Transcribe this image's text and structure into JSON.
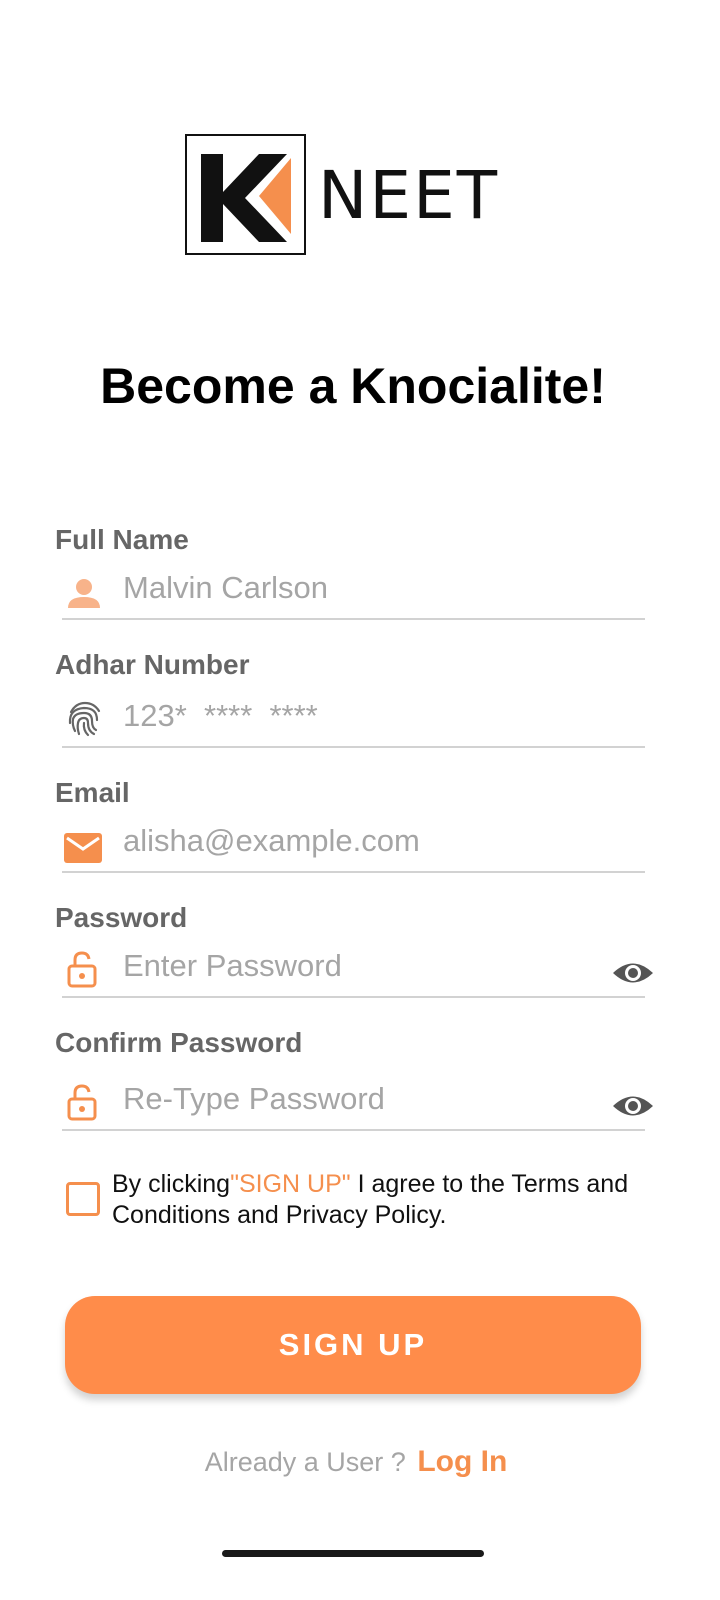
{
  "logo": {
    "letter": "K",
    "wordmark": "NEET",
    "accent_color": "#F58F4D"
  },
  "title": "Become a Knocialite!",
  "form": {
    "full_name": {
      "label": "Full Name",
      "placeholder": "Malvin Carlson",
      "icon": "person-icon"
    },
    "adhar": {
      "label": "Adhar Number",
      "placeholder": "123*  ****  ****",
      "icon": "fingerprint-icon"
    },
    "email": {
      "label": "Email",
      "placeholder": "alisha@example.com",
      "icon": "mail-icon"
    },
    "password": {
      "label": "Password",
      "placeholder": "Enter Password",
      "icon": "lock-icon",
      "toggle_icon": "eye-icon"
    },
    "confirm_password": {
      "label": "Confirm Password",
      "placeholder": "Re-Type Password",
      "icon": "lock-icon",
      "toggle_icon": "eye-icon"
    }
  },
  "agreement": {
    "checked": false,
    "prefix": "By clicking",
    "highlight": "\"SIGN UP\"",
    "suffix": " I agree to the Terms and Conditions and Privacy Policy."
  },
  "signup_button": "SIGN UP",
  "footer": {
    "prompt": "Already a User ?",
    "link": "Log In"
  },
  "colors": {
    "accent": "#F58F4D",
    "button": "#FF8C4A",
    "label": "#666666",
    "placeholder": "#A5A5A5"
  }
}
